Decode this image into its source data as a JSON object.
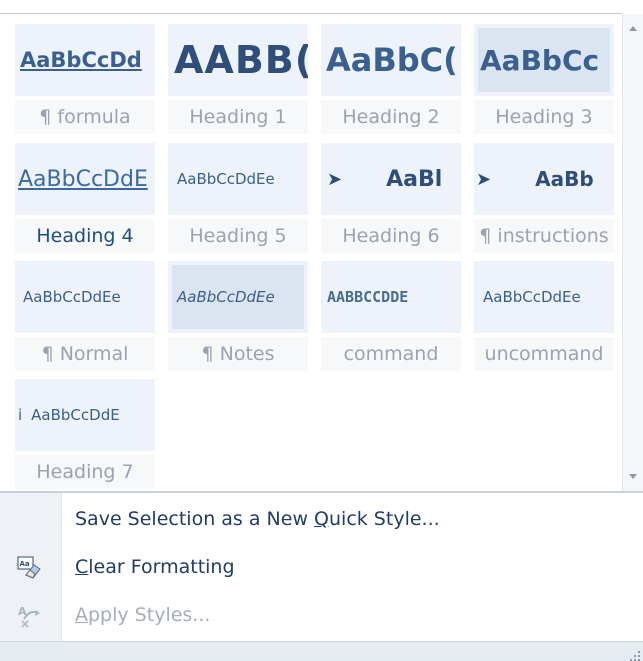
{
  "gallery": {
    "tiles": [
      {
        "preview": "AaBbCcDd",
        "label": "¶ formula"
      },
      {
        "preview": "AABB(",
        "label": "Heading 1"
      },
      {
        "preview": "AaBbC(",
        "label": "Heading 2"
      },
      {
        "preview": "AaBbCc",
        "label": "Heading 3"
      },
      {
        "preview": "AaBbCcDdE",
        "label": "Heading 4"
      },
      {
        "preview": "AaBbCcDdEe",
        "label": "Heading 5"
      },
      {
        "preview": "AaBl",
        "label": "Heading 6"
      },
      {
        "preview": "AaBb",
        "label": "¶ instructions"
      },
      {
        "preview": "AaBbCcDdEe",
        "label": "¶ Normal"
      },
      {
        "preview": "AaBbCcDdEe",
        "label": "¶ Notes"
      },
      {
        "preview": "AABBCCDDE",
        "label": "command"
      },
      {
        "preview": "AaBbCcDdEe",
        "label": "uncommand"
      },
      {
        "preview": "AaBbCcDdE",
        "label": "Heading 7"
      }
    ],
    "h6_marker": "➤",
    "instr_marker": "➤",
    "h7_prefix": "i"
  },
  "menu": {
    "save_prefix": "Save Selection as a New ",
    "save_accel": "Q",
    "save_suffix": "uick Style...",
    "clear_accel": "C",
    "clear_suffix": "lear Formatting",
    "apply_accel": "A",
    "apply_suffix": "pply Styles..."
  },
  "icons": {
    "clear_formatting": "eraser-icon",
    "apply_styles": "apply-styles-icon",
    "grip": "resize-grip-icon"
  }
}
